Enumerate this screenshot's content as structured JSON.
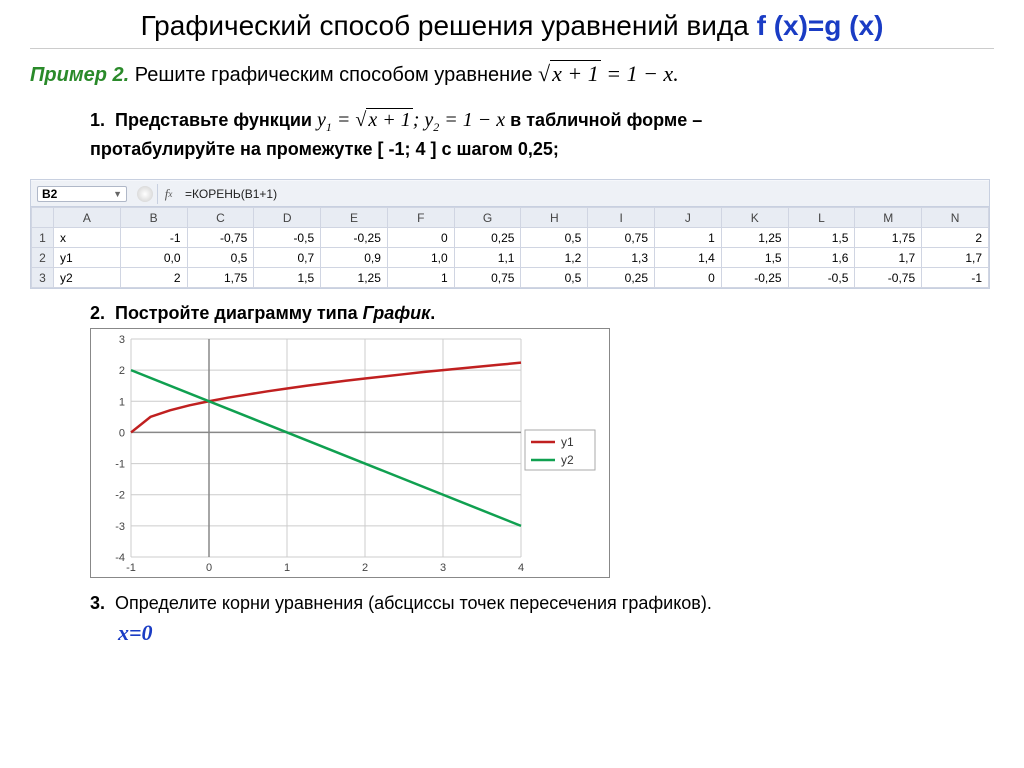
{
  "title_main": "Графический способ решения уравнений вида ",
  "title_fg": "f (x)=g (x)",
  "example_label": "Пример 2.",
  "example_text": " Решите графическим способом уравнение ",
  "equation_lhs_inner": "x + 1",
  "equation_rhs": " = 1 − x.",
  "step1_num": "1.",
  "step1_a": "Представьте функции   ",
  "step1_y1_label": "y",
  "step1_y1_sub": "1",
  "step1_y1_eq": " = ",
  "step1_y1_body": "x + 1",
  "step1_sep": ";  ",
  "step1_y2_label": "y",
  "step1_y2_sub": "2",
  "step1_y2_eq": " = 1 − x",
  "step1_b": "   в табличной форме – ",
  "step1_c": "протабулируйте на промежутке ",
  "step1_interval": "[ -1; 4 ]",
  "step1_d": "  с шагом  ",
  "step1_step": "0,25",
  "step1_e": ";",
  "step2_num": "2.",
  "step2_a": "Постройте диаграмму типа ",
  "step2_b": "График",
  "step2_c": ".",
  "step3_num": "3.",
  "step3_text": "Определите корни уравнения (абсциссы точек пересечения графиков).",
  "answer": "x=0",
  "sheet": {
    "active_cell": "B2",
    "formula": "=КОРЕНЬ(B1+1)",
    "cols": [
      "A",
      "B",
      "C",
      "D",
      "E",
      "F",
      "G",
      "H",
      "I",
      "J",
      "K",
      "L",
      "M",
      "N"
    ],
    "rows": [
      {
        "n": "1",
        "label": "x",
        "v": [
          "-1",
          "-0,75",
          "-0,5",
          "-0,25",
          "0",
          "0,25",
          "0,5",
          "0,75",
          "1",
          "1,25",
          "1,5",
          "1,75",
          "2"
        ]
      },
      {
        "n": "2",
        "label": "y1",
        "v": [
          "0,0",
          "0,5",
          "0,7",
          "0,9",
          "1,0",
          "1,1",
          "1,2",
          "1,3",
          "1,4",
          "1,5",
          "1,6",
          "1,7",
          "1,7"
        ]
      },
      {
        "n": "3",
        "label": "y2",
        "v": [
          "2",
          "1,75",
          "1,5",
          "1,25",
          "1",
          "0,75",
          "0,5",
          "0,25",
          "0",
          "-0,25",
          "-0,5",
          "-0,75",
          "-1"
        ]
      }
    ]
  },
  "chart_data": {
    "type": "line",
    "xlim": [
      -1,
      4
    ],
    "ylim": [
      -4,
      3
    ],
    "x_ticks": [
      -1,
      0,
      1,
      2,
      3,
      4
    ],
    "y_ticks": [
      -4,
      -3,
      -2,
      -1,
      0,
      1,
      2,
      3
    ],
    "series": [
      {
        "name": "y1",
        "color": "#c02020",
        "x": [
          -1,
          -0.75,
          -0.5,
          -0.25,
          0,
          0.25,
          0.5,
          0.75,
          1,
          1.25,
          1.5,
          1.75,
          2,
          2.25,
          2.5,
          2.75,
          3,
          3.25,
          3.5,
          3.75,
          4
        ],
        "y": [
          0,
          0.5,
          0.71,
          0.87,
          1,
          1.12,
          1.22,
          1.32,
          1.41,
          1.5,
          1.58,
          1.66,
          1.73,
          1.8,
          1.87,
          1.94,
          2,
          2.06,
          2.12,
          2.18,
          2.24
        ]
      },
      {
        "name": "y2",
        "color": "#10a050",
        "x": [
          -1,
          4
        ],
        "y": [
          2,
          -3
        ]
      }
    ],
    "legend": [
      "y1",
      "y2"
    ]
  }
}
